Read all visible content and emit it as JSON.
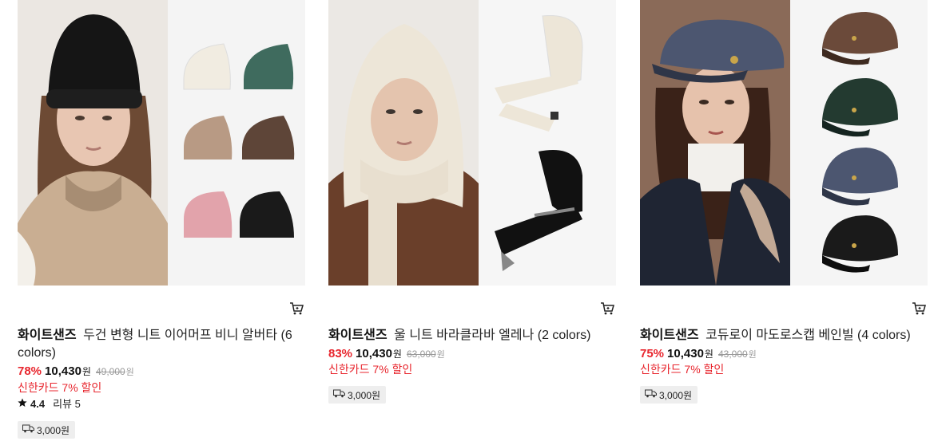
{
  "products": [
    {
      "brand": "화이트샌즈",
      "name": "두건 변형 니트 이어머프 비니 알버타 (6 colors)",
      "discount": "78%",
      "price": "10,430",
      "won": "원",
      "original_price": "49,000",
      "card_promo": "신한카드 7% 할인",
      "rating": "4.4",
      "reviews": "리뷰 5",
      "shipping": "3,000원",
      "swatch_colors": [
        "#f1ece1",
        "#3f6b5e",
        "#b89a84",
        "#5e4538",
        "#e2a3ab",
        "#1a1a1a"
      ]
    },
    {
      "brand": "화이트샌즈",
      "name": "울 니트 바라클라바 엘레나 (2 colors)",
      "discount": "83%",
      "price": "10,430",
      "won": "원",
      "original_price": "63,000",
      "card_promo": "신한카드 7% 할인",
      "shipping": "3,000원",
      "swatch_colors": [
        "#ede6d8",
        "#111111"
      ]
    },
    {
      "brand": "화이트샌즈",
      "name": "코듀로이 마도로스캡 베인빌 (4 colors)",
      "discount": "75%",
      "price": "10,430",
      "won": "원",
      "original_price": "43,000",
      "card_promo": "신한카드 7% 할인",
      "shipping": "3,000원",
      "swatch_colors": [
        "#6b4a3a",
        "#233a30",
        "#4c5670",
        "#1a1a1a"
      ]
    }
  ],
  "colors": {
    "discount": "#e8262e",
    "promo": "#e8262e",
    "strikethrough": "#999999",
    "badge_bg": "#eeeeee"
  },
  "icons": [
    "cart-icon",
    "star-icon",
    "truck-icon"
  ]
}
